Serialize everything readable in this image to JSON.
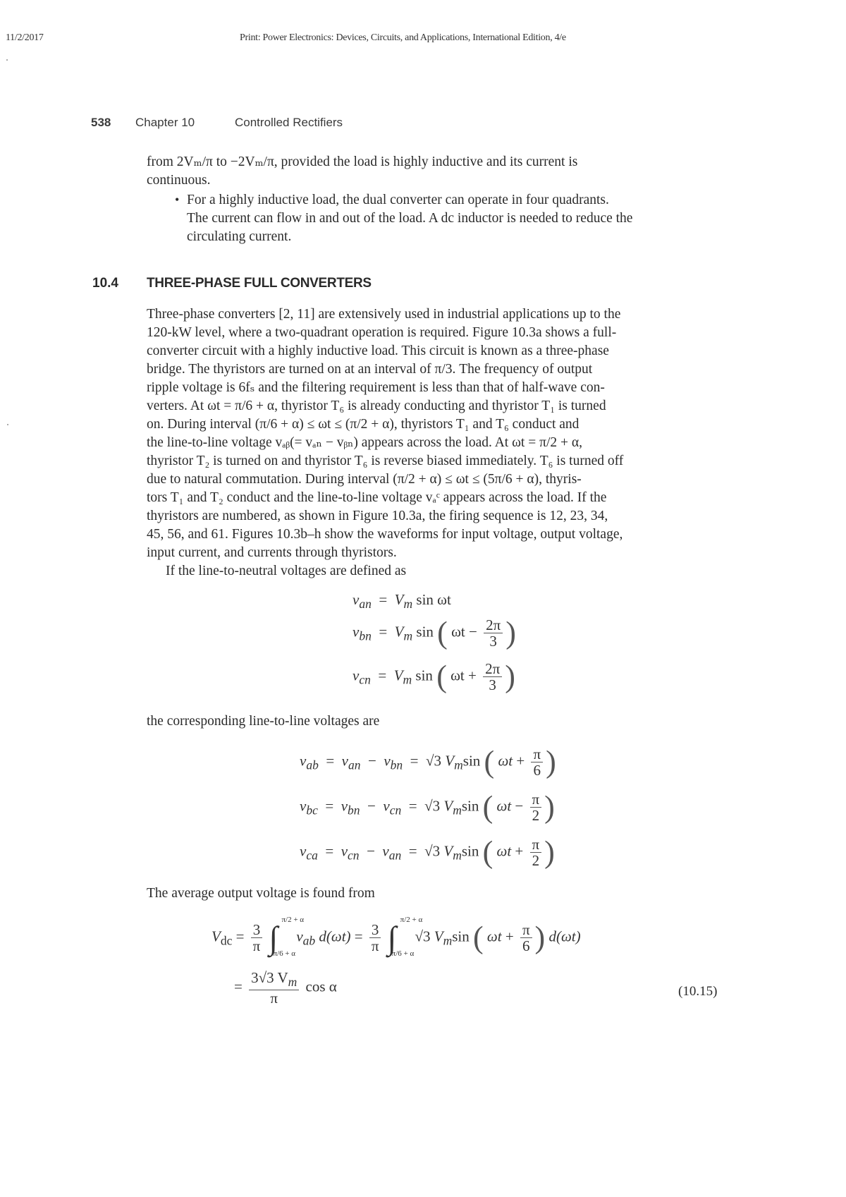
{
  "print_header": {
    "date": "11/2/2017",
    "title": "Print: Power Electronics: Devices, Circuits, and Applications, International Edition, 4/e"
  },
  "running_head": {
    "page_number": "538",
    "chapter": "Chapter 10",
    "chapter_title": "Controlled Rectifiers"
  },
  "intro": {
    "continued_line_1": "from 2Vₘ/π to −2Vₘ/π, provided the load is highly inductive and its current is",
    "continued_line_2": "continuous.",
    "bullet_line_1": "For a highly inductive load, the dual converter can operate in four quadrants.",
    "bullet_line_2": "The current can flow in and out of the load. A dc inductor is needed to reduce the",
    "bullet_line_3": "circulating current."
  },
  "section": {
    "number": "10.4",
    "title": "THREE-PHASE FULL CONVERTERS",
    "paragraph_lines": [
      "Three-phase converters [2, 11] are extensively used in industrial applications up to the",
      "120-kW level, where a two-quadrant operation is required. Figure 10.3a shows a full-",
      "converter circuit with a highly inductive load. This circuit is known as a three-phase",
      "bridge. The thyristors are turned on at an interval of π/3. The frequency of output",
      "ripple voltage is 6fₛ and the filtering requirement is less than that of half-wave con-",
      "verters. At ωt = π/6 + α, thyristor T₆ is already conducting and thyristor T₁ is turned",
      "on. During interval (π/6 + α) ≤ ωt ≤ (π/2 + α), thyristors T₁ and T₆ conduct and",
      "the line-to-line voltage vₐᵦ(= vₐₙ − vᵦₙ) appears across the load. At ωt = π/2 + α,",
      "thyristor T₂ is turned on and thyristor T₆ is reverse biased immediately. T₆ is turned off",
      "due to natural commutation. During interval (π/2 + α) ≤ ωt ≤ (5π/6 + α), thyris-",
      "tors T₁ and T₂ conduct and the line-to-line voltage vₐᶜ appears across the load. If the",
      "thyristors are numbered, as shown in Figure 10.3a, the firing sequence is 12, 23, 34,",
      "45, 56, and 61. Figures 10.3b–h show the waveforms for input voltage, output voltage,",
      "input current, and currents through thyristors."
    ],
    "line_to_neutral_intro": "If the line-to-neutral voltages are defined as",
    "line_to_line_intro": "the corresponding line-to-line voltages are",
    "average_intro": "The average output voltage is found from"
  },
  "equations": {
    "van": {
      "lhs": "v",
      "lhs_sub": "an",
      "rhs": "V",
      "rhs_sub": "m",
      "fn": "sin ωt"
    },
    "vbn": {
      "lhs": "v",
      "lhs_sub": "bn",
      "coef": "V",
      "coef_sub": "m",
      "fn": "sin",
      "arg": "ωt",
      "op": "−",
      "num": "2π",
      "den": "3"
    },
    "vcn": {
      "lhs": "v",
      "lhs_sub": "cn",
      "coef": "V",
      "coef_sub": "m",
      "fn": "sin",
      "arg": "ωt",
      "op": "+",
      "num": "2π",
      "den": "3"
    },
    "vab": {
      "lhs_sub": "ab",
      "a_sub": "an",
      "b_sub": "bn",
      "root": "√3",
      "op": "+",
      "num": "π",
      "den": "6"
    },
    "vbc": {
      "lhs_sub": "bc",
      "a_sub": "bn",
      "b_sub": "cn",
      "root": "√3",
      "op": "−",
      "num": "π",
      "den": "2"
    },
    "vca": {
      "lhs_sub": "ca",
      "a_sub": "cn",
      "b_sub": "an",
      "root": "√3",
      "op": "+",
      "num": "π",
      "den": "2"
    },
    "vdc": {
      "lhs": "V",
      "lhs_sub": "dc",
      "factor_num": "3",
      "factor_den": "π",
      "upper_limit": "π/2 + α",
      "lower_limit": "π/6 + α",
      "integrand_1": "v",
      "integrand_1_sub": "ab",
      "dwt": "d(ωt)",
      "root": "√3",
      "op": "+",
      "num": "π",
      "den": "6",
      "result_num": "3√3 V",
      "result_num_sub": "m",
      "result_den": "π",
      "result_tail": "cos α",
      "number": "(10.15)"
    }
  }
}
